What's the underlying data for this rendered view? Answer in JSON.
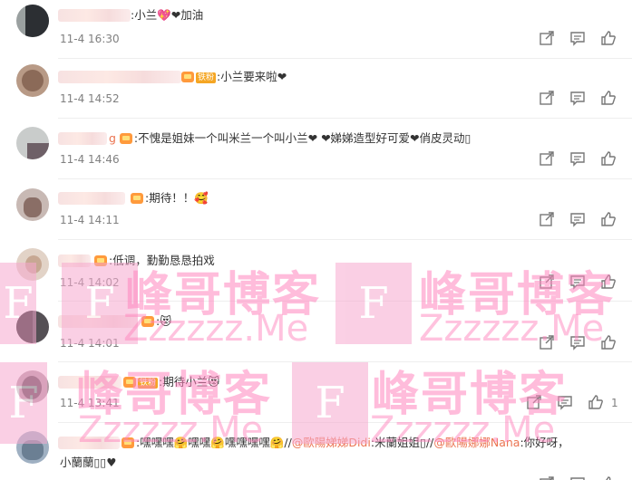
{
  "comments": [
    {
      "text": ":小兰💖❤加油",
      "time": "11-4 16:30"
    },
    {
      "badge": "铁粉",
      "text": ":小兰要来啦❤",
      "time": "11-4 14:52"
    },
    {
      "name_suffix": "g",
      "text": ":不愧是姐妹一个叫米兰一个叫小兰❤ ❤娣娣造型好可爱❤俏皮灵动▯",
      "time": "11-4 14:46"
    },
    {
      "text": ":期待！！🥰",
      "time": "11-4 14:11"
    },
    {
      "text": ":低调，勤勤恳恳拍戏",
      "time": "11-4 14:02"
    },
    {
      "text": ":😻",
      "time": "11-4 14:01"
    },
    {
      "badge": "铁粉",
      "text": ":期待小兰😻",
      "time": "11-4 13:41",
      "like_count": "1"
    },
    {
      "text_a": ":嘿嘿嘿🤗嘿嘿🤗嘿嘿嘿嘿🤗//",
      "mention1": "@歐陽娣娣Didi",
      "text_b": ":米蘭姐姐▯//",
      "mention2": "@歐陽娜娜Nana",
      "text_c": ":你好呀，",
      "text_line2": "小蘭蘭▯▯♥"
    }
  ],
  "icons": {
    "share": "share-icon",
    "comment": "comment-icon",
    "like": "thumbs-up-icon"
  },
  "watermark": {
    "cn": "峰哥博客",
    "en": "Zzzzzz.Me",
    "f": "F"
  },
  "colors": {
    "mention": "#eb7350",
    "heart": "#e8423a",
    "watermark": "#ff86be",
    "time": "#808080"
  }
}
